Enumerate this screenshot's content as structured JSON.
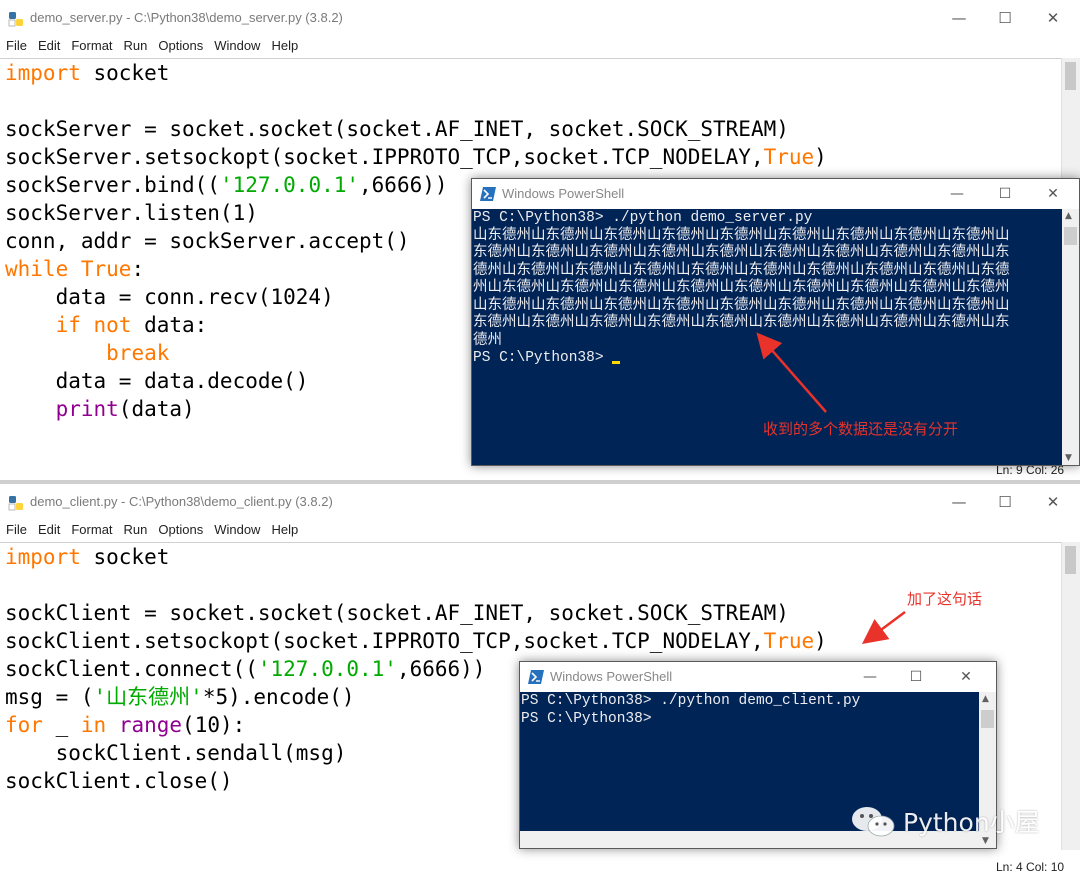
{
  "server_window": {
    "title": "demo_server.py - C:\\Python38\\demo_server.py (3.8.2)",
    "minimize": "—",
    "maximize": "☐",
    "close": "✕",
    "menu": [
      "File",
      "Edit",
      "Format",
      "Run",
      "Options",
      "Window",
      "Help"
    ],
    "code": [
      [
        {
          "t": "import",
          "c": "kw"
        },
        {
          "t": " socket",
          "c": ""
        }
      ],
      [],
      [
        {
          "t": "sockServer = socket.socket(socket.AF_INET, socket.SOCK_STREAM)",
          "c": ""
        }
      ],
      [
        {
          "t": "sockServer.setsockopt(socket.IPPROTO_TCP,socket.TCP_NODELAY,",
          "c": ""
        },
        {
          "t": "True",
          "c": "kw"
        },
        {
          "t": ")",
          "c": ""
        }
      ],
      [
        {
          "t": "sockServer.bind((",
          "c": ""
        },
        {
          "t": "'127.0.0.1'",
          "c": "str"
        },
        {
          "t": ",6666))",
          "c": ""
        }
      ],
      [
        {
          "t": "sockServer.listen(1)",
          "c": ""
        }
      ],
      [
        {
          "t": "conn, addr = sockServer.accept()",
          "c": ""
        }
      ],
      [
        {
          "t": "while",
          "c": "kw"
        },
        {
          "t": " ",
          "c": ""
        },
        {
          "t": "True",
          "c": "kw"
        },
        {
          "t": ":",
          "c": ""
        }
      ],
      [
        {
          "t": "    data = conn.recv(1024)",
          "c": ""
        }
      ],
      [
        {
          "t": "    ",
          "c": ""
        },
        {
          "t": "if",
          "c": "kw"
        },
        {
          "t": " ",
          "c": ""
        },
        {
          "t": "not",
          "c": "kw"
        },
        {
          "t": " data:",
          "c": ""
        }
      ],
      [
        {
          "t": "        ",
          "c": ""
        },
        {
          "t": "break",
          "c": "kw"
        }
      ],
      [
        {
          "t": "    data = data.decode()",
          "c": ""
        }
      ],
      [
        {
          "t": "    ",
          "c": ""
        },
        {
          "t": "print",
          "c": "bi"
        },
        {
          "t": "(data)",
          "c": ""
        }
      ]
    ],
    "status": "Ln: 9   Col: 26"
  },
  "client_window": {
    "title": "demo_client.py - C:\\Python38\\demo_client.py (3.8.2)",
    "minimize": "—",
    "maximize": "☐",
    "close": "✕",
    "menu": [
      "File",
      "Edit",
      "Format",
      "Run",
      "Options",
      "Window",
      "Help"
    ],
    "code": [
      [
        {
          "t": "import",
          "c": "kw"
        },
        {
          "t": " socket",
          "c": ""
        }
      ],
      [],
      [
        {
          "t": "sockClient = socket.socket(socket.AF_INET, socket.SOCK_STREAM)",
          "c": ""
        }
      ],
      [
        {
          "t": "sockClient.setsockopt(socket.IPPROTO_TCP,socket.TCP_NODELAY,",
          "c": ""
        },
        {
          "t": "True",
          "c": "kw"
        },
        {
          "t": ")",
          "c": ""
        }
      ],
      [
        {
          "t": "sockClient.connect((",
          "c": ""
        },
        {
          "t": "'127.0.0.1'",
          "c": "str"
        },
        {
          "t": ",6666))",
          "c": ""
        }
      ],
      [
        {
          "t": "msg = (",
          "c": ""
        },
        {
          "t": "'山东德州'",
          "c": "str"
        },
        {
          "t": "*5).encode()",
          "c": ""
        }
      ],
      [
        {
          "t": "for",
          "c": "kw"
        },
        {
          "t": " _ ",
          "c": ""
        },
        {
          "t": "in",
          "c": "kw"
        },
        {
          "t": " ",
          "c": ""
        },
        {
          "t": "range",
          "c": "bi"
        },
        {
          "t": "(10):",
          "c": ""
        }
      ],
      [
        {
          "t": "    sockClient.sendall(msg)",
          "c": ""
        }
      ],
      [
        {
          "t": "sockClient.close()",
          "c": ""
        }
      ]
    ],
    "status": "Ln: 4   Col: 10"
  },
  "powershell_server": {
    "title": "Windows PowerShell",
    "minimize": "—",
    "maximize": "☐",
    "close": "✕",
    "lines": [
      "PS C:\\Python38> ./python demo_server.py",
      "山东德州山东德州山东德州山东德州山东德州山东德州山东德州山东德州山东德州山",
      "东德州山东德州山东德州山东德州山东德州山东德州山东德州山东德州山东德州山东",
      "德州山东德州山东德州山东德州山东德州山东德州山东德州山东德州山东德州山东德",
      "州山东德州山东德州山东德州山东德州山东德州山东德州山东德州山东德州山东德州",
      "山东德州山东德州山东德州山东德州山东德州山东德州山东德州山东德州山东德州山",
      "东德州山东德州山东德州山东德州山东德州山东德州山东德州山东德州山东德州山东",
      "德州"
    ],
    "prompt": "PS C:\\Python38> "
  },
  "powershell_client": {
    "title": "Windows PowerShell",
    "minimize": "—",
    "maximize": "☐",
    "close": "✕",
    "lines": [
      "PS C:\\Python38> ./python demo_client.py",
      "PS C:\\Python38>"
    ]
  },
  "annotations": {
    "server_note": "收到的多个数据还是没有分开",
    "client_note": "加了这句话"
  },
  "watermark": {
    "text": "Python小屋"
  },
  "colors": {
    "keyword": "#ff7700",
    "builtin": "#900090",
    "string": "#00aa00",
    "powershell_bg": "#012456",
    "annotation": "#e8322a"
  }
}
